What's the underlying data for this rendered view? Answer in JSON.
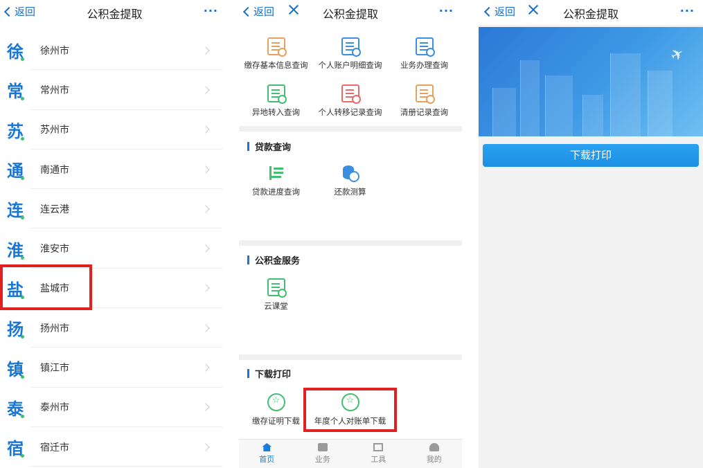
{
  "panel1": {
    "nav": {
      "back_label": "返回",
      "title": "公积金提取",
      "more": "···"
    },
    "cities": [
      {
        "glyph": "徐",
        "name": "徐州市"
      },
      {
        "glyph": "常",
        "name": "常州市"
      },
      {
        "glyph": "苏",
        "name": "苏州市"
      },
      {
        "glyph": "通",
        "name": "南通市"
      },
      {
        "glyph": "连",
        "name": "连云港"
      },
      {
        "glyph": "淮",
        "name": "淮安市"
      },
      {
        "glyph": "盐",
        "name": "盐城市"
      },
      {
        "glyph": "扬",
        "name": "扬州市"
      },
      {
        "glyph": "镇",
        "name": "镇江市"
      },
      {
        "glyph": "泰",
        "name": "泰州市"
      },
      {
        "glyph": "宿",
        "name": "宿迁市"
      }
    ]
  },
  "panel2": {
    "nav": {
      "back_label": "返回",
      "title": "公积金提取",
      "more": "···"
    },
    "query_items": [
      {
        "label": "缴存基本信息查询",
        "icon": "doc-search-icon",
        "color": "#e8a05c"
      },
      {
        "label": "个人账户明细查询",
        "icon": "account-detail-icon",
        "color": "#3a8fe0"
      },
      {
        "label": "业务办理查询",
        "icon": "business-search-icon",
        "color": "#3a8fe0"
      },
      {
        "label": "异地转入查询",
        "icon": "transfer-in-icon",
        "color": "#3fbf6f"
      },
      {
        "label": "个人转移记录查询",
        "icon": "transfer-record-icon",
        "color": "#e86a6a"
      },
      {
        "label": "清册记录查询",
        "icon": "register-record-icon",
        "color": "#e8a05c"
      }
    ],
    "loan": {
      "title": "贷款查询",
      "items": [
        {
          "label": "贷款进度查询",
          "icon": "loan-progress-icon",
          "color": "#3fbf6f"
        },
        {
          "label": "还款测算",
          "icon": "repayment-calc-icon",
          "color": "#3a8fe0"
        }
      ]
    },
    "service": {
      "title": "公积金服务",
      "items": [
        {
          "label": "云课堂",
          "icon": "cloud-class-icon",
          "color": "#3fbf6f"
        }
      ]
    },
    "download": {
      "title": "下载打印",
      "items": [
        {
          "label": "缴存证明下载",
          "icon": "certificate-download-icon",
          "color": "#3fbf6f"
        },
        {
          "label": "年度个人对账单下载",
          "icon": "statement-download-icon",
          "color": "#3fbf6f"
        }
      ]
    },
    "tabs": [
      {
        "label": "首页",
        "icon": "home-icon"
      },
      {
        "label": "业务",
        "icon": "briefcase-icon"
      },
      {
        "label": "工具",
        "icon": "tools-icon"
      },
      {
        "label": "我的",
        "icon": "user-icon"
      }
    ]
  },
  "panel3": {
    "nav": {
      "back_label": "返回",
      "title": "公积金提取",
      "more": "···"
    },
    "banner_icon": "airplane-icon",
    "download_button": "下载打印"
  }
}
